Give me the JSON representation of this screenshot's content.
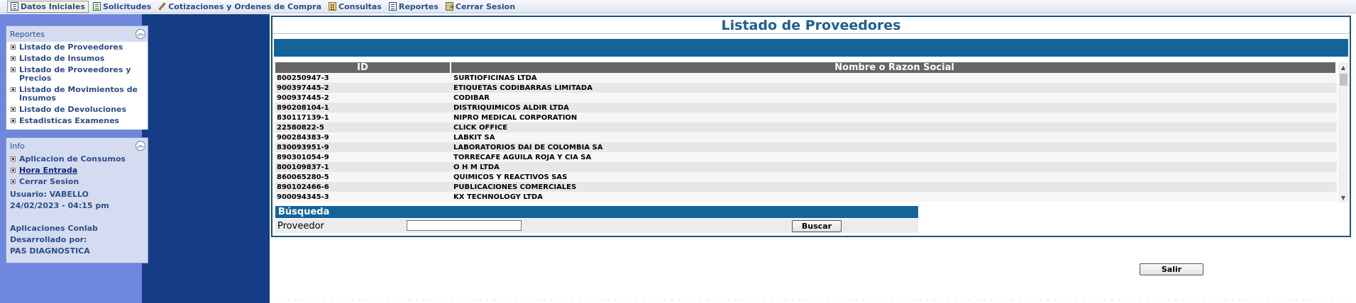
{
  "menu": [
    {
      "label": "Datos Iniciales",
      "icon": "document-icon",
      "active": true
    },
    {
      "label": "Solicitudes",
      "icon": "green-document-icon",
      "active": false
    },
    {
      "label": "Cotizaciones y Ordenes de Compra",
      "icon": "pencil-icon",
      "active": false
    },
    {
      "label": "Consultas",
      "icon": "calculator-icon",
      "active": false
    },
    {
      "label": "Reportes",
      "icon": "document-icon",
      "active": false
    },
    {
      "label": "Cerrar Sesion",
      "icon": "exit-icon",
      "active": false
    }
  ],
  "sidebar": {
    "reportes": {
      "title": "Reportes",
      "items": [
        "Listado de Proveedores",
        "Listado de Insumos",
        "Listado de Proveedores y Precios",
        "Listado de Movimientos de Insumos",
        "Listado de Devoluciones",
        "Estadisticas Examenes"
      ]
    },
    "info": {
      "title": "Info",
      "items": [
        "Aplicacion de Consumos",
        "Hora Entrada",
        "Cerrar Sesion"
      ],
      "user": "Usuario: VABELLO",
      "datetime": "24/02/2023 - 04:15 pm",
      "app": "Aplicaciones Conlab",
      "dev_label": "Desarrollado por:",
      "dev": "PAS DIAGNOSTICA"
    }
  },
  "main": {
    "title": "Listado de Proveedores",
    "columns": [
      "ID",
      "Nombre o Razon Social"
    ],
    "rows": [
      [
        "800250947-3",
        "SURTIOFICINAS LTDA"
      ],
      [
        "900397445-2",
        "ETIQUETAS CODIBARRAS LIMITADA"
      ],
      [
        "900937445-2",
        "CODIBAR"
      ],
      [
        "890208104-1",
        "DISTRIQUIMICOS ALDIR LTDA"
      ],
      [
        "830117139-1",
        "NIPRO MEDICAL CORPORATION"
      ],
      [
        "22580822-5",
        "CLICK OFFICE"
      ],
      [
        "900284383-9",
        "LABKIT SA"
      ],
      [
        "830093951-9",
        "LABORATORIOS DAI DE COLOMBIA SA"
      ],
      [
        "890301054-9",
        "TORRECAFE AGUILA ROJA Y CIA SA"
      ],
      [
        "800109837-1",
        "O H M LTDA"
      ],
      [
        "860065280-5",
        "QUIMICOS Y REACTIVOS SAS"
      ],
      [
        "890102466-6",
        "PUBLICACIONES COMERCIALES"
      ],
      [
        "900094345-3",
        "KX TECHNOLOGY LTDA"
      ]
    ],
    "search": {
      "title": "Búsqueda",
      "label": "Proveedor",
      "value": "",
      "button": "Buscar"
    },
    "exit_button": "Salir"
  },
  "scrollbar": {
    "up": "▲",
    "down": "▼"
  },
  "colors": {
    "accent": "#14649a",
    "navy": "#153d85",
    "sidebar_bg": "#6f87dc",
    "menu_text": "#2d4e88"
  }
}
